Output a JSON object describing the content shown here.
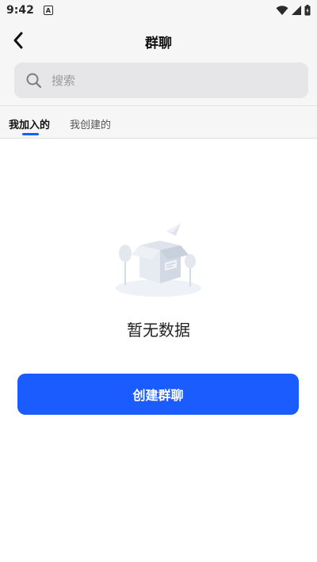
{
  "status_bar": {
    "time": "9:42",
    "notification_icon": "a-icon",
    "icons": [
      "wifi-icon",
      "signal-icon",
      "battery-charging-icon"
    ]
  },
  "header": {
    "title": "群聊",
    "back_icon": "chevron-left-icon"
  },
  "search": {
    "placeholder": "搜索",
    "value": ""
  },
  "tabs": [
    {
      "label": "我加入的",
      "active": true
    },
    {
      "label": "我创建的",
      "active": false
    }
  ],
  "empty_state": {
    "message": "暂无数据"
  },
  "actions": {
    "create_label": "创建群聊"
  },
  "colors": {
    "accent": "#1a5cff",
    "background": "#f6f6f7",
    "content_background": "#ffffff"
  }
}
